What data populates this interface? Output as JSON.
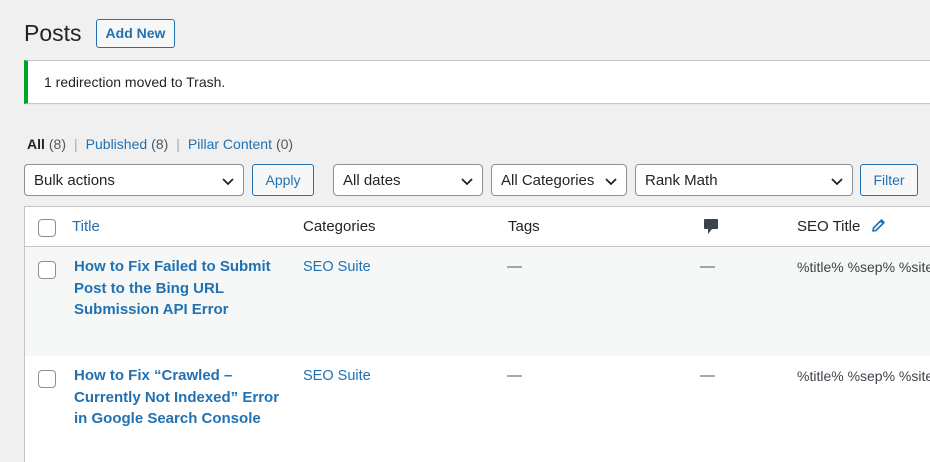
{
  "page": {
    "title": "Posts",
    "add_new": "Add New"
  },
  "notice": {
    "message": "1 redirection moved to Trash.",
    "color": "#00a32a"
  },
  "views": [
    {
      "label": "All",
      "count": "(8)"
    },
    {
      "label": "Published",
      "count": "(8)"
    },
    {
      "label": "Pillar Content",
      "count": "(0)"
    }
  ],
  "filters": {
    "bulk_actions": "Bulk actions",
    "apply": "Apply",
    "dates": "All dates",
    "categories": "All Categories",
    "seo": "Rank Math",
    "filter": "Filter"
  },
  "columns": {
    "title": "Title",
    "categories": "Categories",
    "tags": "Tags",
    "comments_icon": "comment-bubble-icon",
    "seo_title": "SEO Title",
    "seo_edit_icon": "pencil-icon"
  },
  "rows": [
    {
      "title": "How to Fix Failed to Submit Post to the Bing URL Submission API Error",
      "category": "SEO Suite",
      "tags": "—",
      "comments": "—",
      "seo_title": "%title% %sep% %site%"
    },
    {
      "title": "How to Fix “Crawled – Currently Not Indexed” Error in Google Search Console",
      "category": "SEO Suite",
      "tags": "—",
      "comments": "—",
      "seo_title": "%title% %sep% %site%"
    }
  ],
  "colors": {
    "link": "#2271b1",
    "text": "#1d2327",
    "background": "#f0f0f1"
  }
}
